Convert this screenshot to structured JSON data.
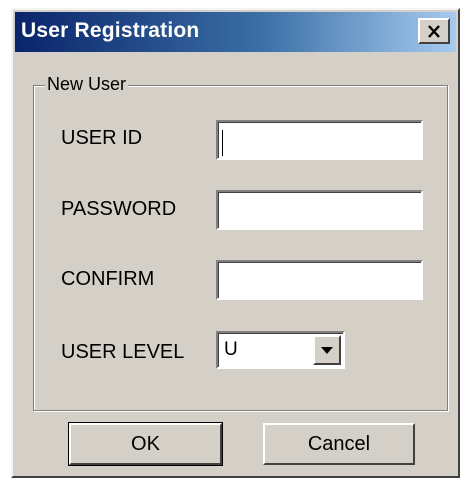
{
  "window": {
    "title": "User Registration",
    "close_glyph": "✕"
  },
  "group": {
    "legend": "New User"
  },
  "fields": {
    "user_id_label": "USER ID",
    "user_id_value": "",
    "password_label": "PASSWORD",
    "password_value": "",
    "confirm_label": "CONFIRM",
    "confirm_value": "",
    "user_level_label": "USER LEVEL",
    "user_level_value": "U"
  },
  "buttons": {
    "ok_label": "OK",
    "cancel_label": "Cancel"
  },
  "colors": {
    "dialog_face": "#d4d0c8",
    "titlebar_start": "#0a246a",
    "titlebar_end": "#a6caf0"
  }
}
